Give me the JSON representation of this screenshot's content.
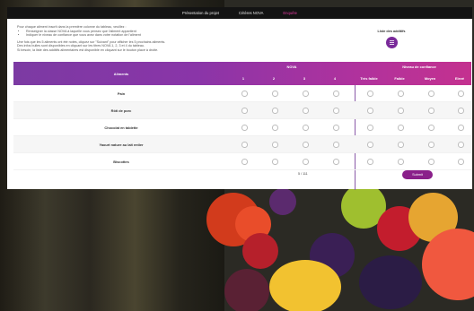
{
  "nav": {
    "items": [
      {
        "label": "Présentation du projet",
        "active": false
      },
      {
        "label": "Critères NOVA",
        "active": false
      },
      {
        "label": "Enquête",
        "active": true
      }
    ]
  },
  "instructions": {
    "line1": "Pour chaque aliment inscrit dans la première colonne du tableau, veuillez :",
    "bullet1": "Renseigner la classe NOVA à laquelle vous pensez que l'aliment appartient",
    "bullet2": "Indiquer le niveau de confiance que vous avez dans votre notation de l'aliment",
    "line2": "Une fois que les 5 aliments ont été notés, cliquez sur \"Suivant\" pour afficher les 5 prochains aliments.",
    "line3": "Des infos bulles sont disponibles en cliquant sur les titres NOVA 1, 2, 3 et 4 du tableau.",
    "line4": "Si besoin, la liste des additifs alimentaires est disponible en cliquant sur le bouton placé à droite."
  },
  "additives": {
    "label": "Liste des additifs"
  },
  "table": {
    "food_header": "Aliments",
    "nova_header": "NOVA",
    "nova_cols": [
      "1",
      "2",
      "3",
      "4"
    ],
    "conf_header": "Niveau de confiance",
    "conf_cols": [
      "Très faible",
      "Faible",
      "Moyen",
      "Elevé"
    ],
    "rows": [
      "Pain",
      "Rôti de porc",
      "Chocolat en tablette",
      "Yaourt nature au lait entier",
      "Biscottes"
    ]
  },
  "pager": {
    "text": "5 / 111"
  },
  "submit": {
    "label": "Submit"
  },
  "colors": {
    "header_start": "#7c3aa3",
    "header_end": "#c4318f",
    "active_nav": "#e0389e",
    "submit": "#8a1f8a"
  },
  "icons": {
    "additives_button": "list-icon"
  }
}
